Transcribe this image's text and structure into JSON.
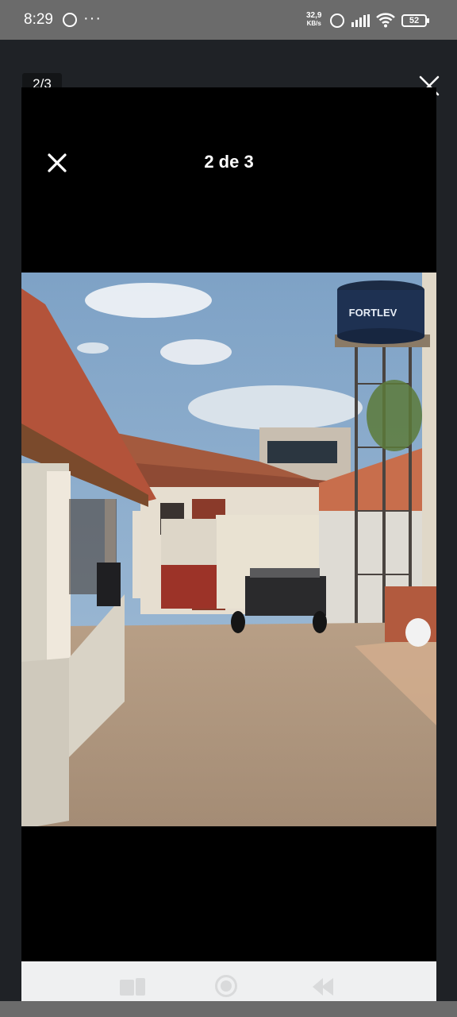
{
  "status_bar": {
    "time": "8:29",
    "more_indicator": "···",
    "net_speed_value": "32,9",
    "net_speed_unit": "KB/s",
    "battery": "52",
    "icons": [
      "whatsapp-icon",
      "alarm-icon",
      "signal-icon",
      "wifi-icon",
      "battery-icon"
    ]
  },
  "viewer": {
    "outer_counter": "2/3",
    "inner_counter": "2 de 3",
    "close_icon": "close-icon"
  },
  "photo": {
    "tank_brand": "FORTLEV"
  },
  "navigation": {
    "buttons": [
      "recents-button",
      "home-button",
      "back-button"
    ]
  },
  "colors": {
    "status_bar_bg": "#6b6b6b",
    "viewer_bg": "#000000",
    "nav_bar_bg": "#eff0f1"
  }
}
